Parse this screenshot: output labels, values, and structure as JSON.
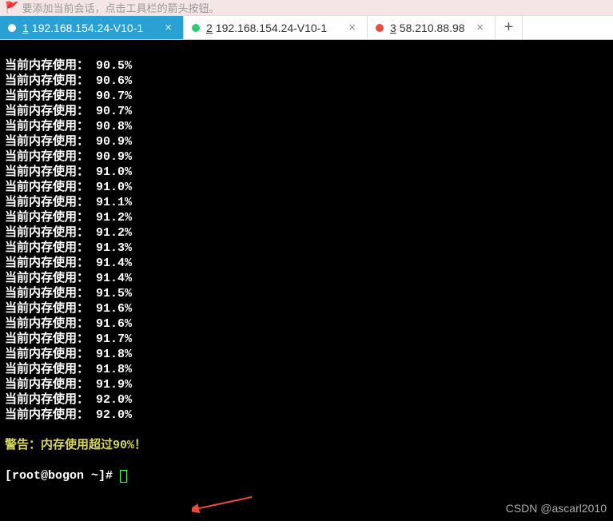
{
  "hint": {
    "text": "要添加当前会话，点击工具栏的箭头按钮。"
  },
  "tabs": [
    {
      "num": "1",
      "label": "192.168.154.24-V10-1",
      "active": true,
      "dot": "white"
    },
    {
      "num": "2",
      "label": "192.168.154.24-V10-1",
      "active": false,
      "dot": "green"
    },
    {
      "num": "3",
      "label": "58.210.88.98",
      "active": false,
      "dot": "red"
    }
  ],
  "addtab": "+",
  "terminal": {
    "label_prefix": "当前内存使用：",
    "values": [
      "90.5%",
      "90.6%",
      "90.7%",
      "90.7%",
      "90.8%",
      "90.9%",
      "90.9%",
      "91.0%",
      "91.0%",
      "91.1%",
      "91.2%",
      "91.2%",
      "91.3%",
      "91.4%",
      "91.4%",
      "91.5%",
      "91.6%",
      "91.6%",
      "91.7%",
      "91.8%",
      "91.8%",
      "91.9%",
      "92.0%",
      "92.0%"
    ],
    "warning": "警告：内存使用超过90%！",
    "prompt": "[root@bogon ~]# "
  },
  "watermark": "CSDN @ascarl2010"
}
